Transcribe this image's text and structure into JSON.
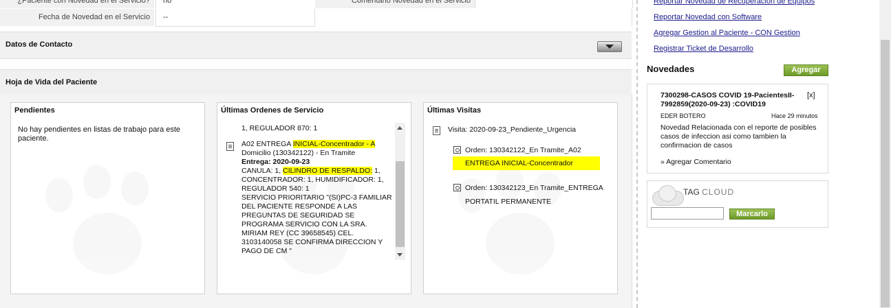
{
  "top_table": {
    "row1": {
      "label1": "¿Paciente con Novedad en el Servicio?",
      "value1": "no",
      "label2": "Comentario Novedad en el Servicio",
      "value2": ""
    },
    "row2": {
      "label1": "Fecha de Novedad en el Servicio",
      "value1": "--"
    }
  },
  "sections": {
    "contacto": "Datos de Contacto",
    "hoja_vida": "Hoja de Vida del Paciente"
  },
  "pendientes": {
    "title": "Pendientes",
    "message": "No hay pendientes en listas de trabajo para este paciente."
  },
  "ordenes": {
    "title": "Últimas Ordenes de Servicio",
    "prev_tail": "1, REGULADOR 870: 1",
    "item": {
      "line1_pre": "A02 ENTREGA ",
      "line1_hl": "INICIAL-Concentrador - A",
      "line2": "Domicilio (130342122) - En Tramite",
      "entrega": "Entrega: 2020-09-23",
      "canula_pre": "CANULA: 1, ",
      "canula_hl": "CILINDRO DE RESPALDO:",
      "canula_post": " 1,",
      "line4": "CONCENTRADOR: 1, HUMIDIFICADOR: 1,",
      "line5": "REGULADOR 540: 1",
      "obs": [
        "SERVICIO PRIORITARIO \"(SI)PC-3 FAMILIAR",
        "DEL PACIENTE RESPONDE A LAS",
        "PREGUNTAS DE SEGURIDAD SE",
        "PROGRAMA SERVICIO CON LA SRA.",
        "MIRIAM REY (CC 39658545) CEL.",
        "3103140058 SE CONFIRMA DIRECCION Y",
        "PAGO DE CM \""
      ]
    }
  },
  "visitas": {
    "title": "Últimas Visitas",
    "visit": "Visita: 2020-09-23_Pendiente_Urgencia",
    "orden1_line1": "Orden: 130342122_En Tramite_A02",
    "orden1_line2": "ENTREGA INICIAL-Concentrador",
    "orden2_line1": "Orden: 130342123_En Tramite_ENTREGA",
    "orden2_line2": "PORTATIL PERMANENTE"
  },
  "right_links": [
    "Reportar Novedad de Recuperación de Equipos",
    "Reportar Novedad con Software",
    "Agregar Gestion al Paciente - CON Gestion",
    "Registrar Ticket de Desarrollo"
  ],
  "novedades": {
    "title": "Novedades",
    "add_label": "Agregar",
    "item": {
      "heading": "7300298-CASOS COVID 19-PacientesII-7992859(2020-09-23) :COVID19",
      "close": "[x]",
      "author": "EDER BOTERO",
      "time": "Hace 29 minutos",
      "body": "Novedad Relacionada con el reporte de posibles casos de infeccion asi como tambien la confirmacion de casos",
      "comment_link": "» Agregar Comentario"
    }
  },
  "tag_cloud": {
    "title_a": "TAG",
    "title_b": "CLOUD",
    "input_value": "",
    "button": "Marcarlo"
  },
  "colors": {
    "highlight": "#ffff00",
    "green_button": "#7aa635",
    "link": "#1a1a8c"
  }
}
